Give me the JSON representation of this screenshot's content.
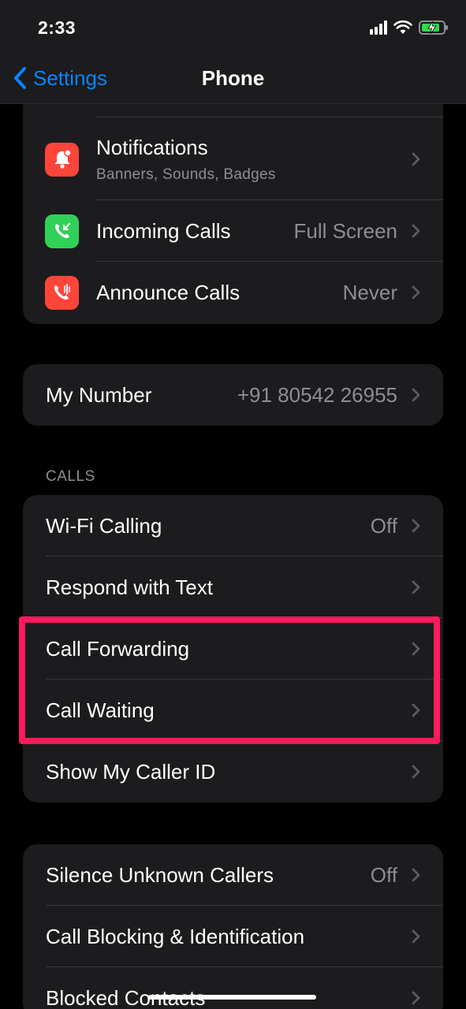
{
  "status_bar": {
    "time": "2:33"
  },
  "nav": {
    "back_label": "Settings",
    "title": "Phone"
  },
  "group1": {
    "notifications": {
      "label": "Notifications",
      "sublabel": "Banners, Sounds, Badges",
      "icon": "bell-icon",
      "icon_color": "#ff453a"
    },
    "incoming_calls": {
      "label": "Incoming Calls",
      "value": "Full Screen",
      "icon": "incoming-call-icon",
      "icon_color": "#30d158"
    },
    "announce_calls": {
      "label": "Announce Calls",
      "value": "Never",
      "icon": "announce-call-icon",
      "icon_color": "#ff453a"
    }
  },
  "my_number": {
    "label": "My Number",
    "value": "+91 80542 26955"
  },
  "calls": {
    "header": "CALLS",
    "wifi_calling": {
      "label": "Wi-Fi Calling",
      "value": "Off"
    },
    "respond_with_text": {
      "label": "Respond with Text"
    },
    "call_forwarding": {
      "label": "Call Forwarding"
    },
    "call_waiting": {
      "label": "Call Waiting"
    },
    "show_caller_id": {
      "label": "Show My Caller ID"
    }
  },
  "group4": {
    "silence_unknown": {
      "label": "Silence Unknown Callers",
      "value": "Off"
    },
    "call_blocking": {
      "label": "Call Blocking & Identification"
    },
    "blocked_contacts": {
      "label": "Blocked Contacts"
    }
  },
  "colors": {
    "accent": "#0a84ff",
    "highlight": "#ff1a5e",
    "battery": "#32d74b"
  },
  "battery_level": 0.85
}
